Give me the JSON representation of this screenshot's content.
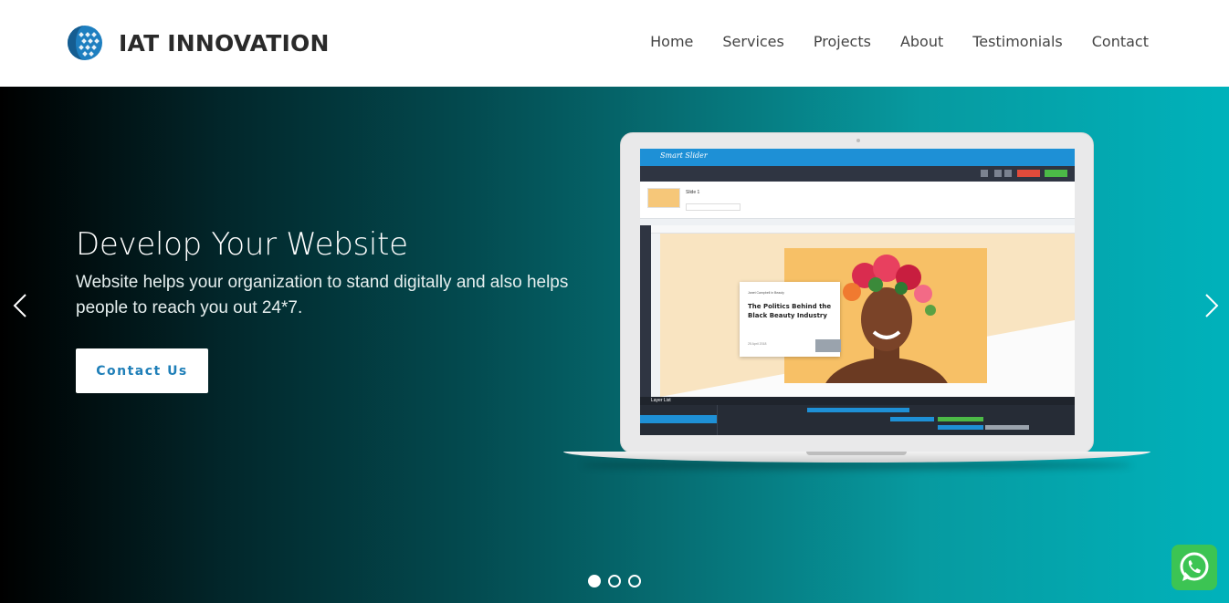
{
  "header": {
    "brand_name": "IAT INNOVATION",
    "nav": [
      "Home",
      "Services",
      "Projects",
      "About",
      "Testimonials",
      "Contact"
    ]
  },
  "hero": {
    "title": "Develop Your Website",
    "text": "Website helps your organization to stand digitally and also helps people to reach you out 24*7.",
    "cta_label": "Contact Us",
    "active_slide": 1,
    "slide_count": 3
  },
  "laptop_screen": {
    "app_logo": "Smart Slider",
    "slide_label": "Slide 1",
    "card_author": "Janet Campbell in Beauty",
    "card_title": "The Politics Behind the Black Beauty Industry",
    "card_date": "25 April 2018",
    "layer_list_label": "Layer List"
  },
  "colors": {
    "accent": "#1f7fb8",
    "hero_gradient_start": "#000000",
    "hero_gradient_end": "#00b2bb",
    "whatsapp": "#3cc453"
  },
  "icons": [
    "globe-logo-icon",
    "chevron-left-icon",
    "chevron-right-icon",
    "whatsapp-icon"
  ]
}
